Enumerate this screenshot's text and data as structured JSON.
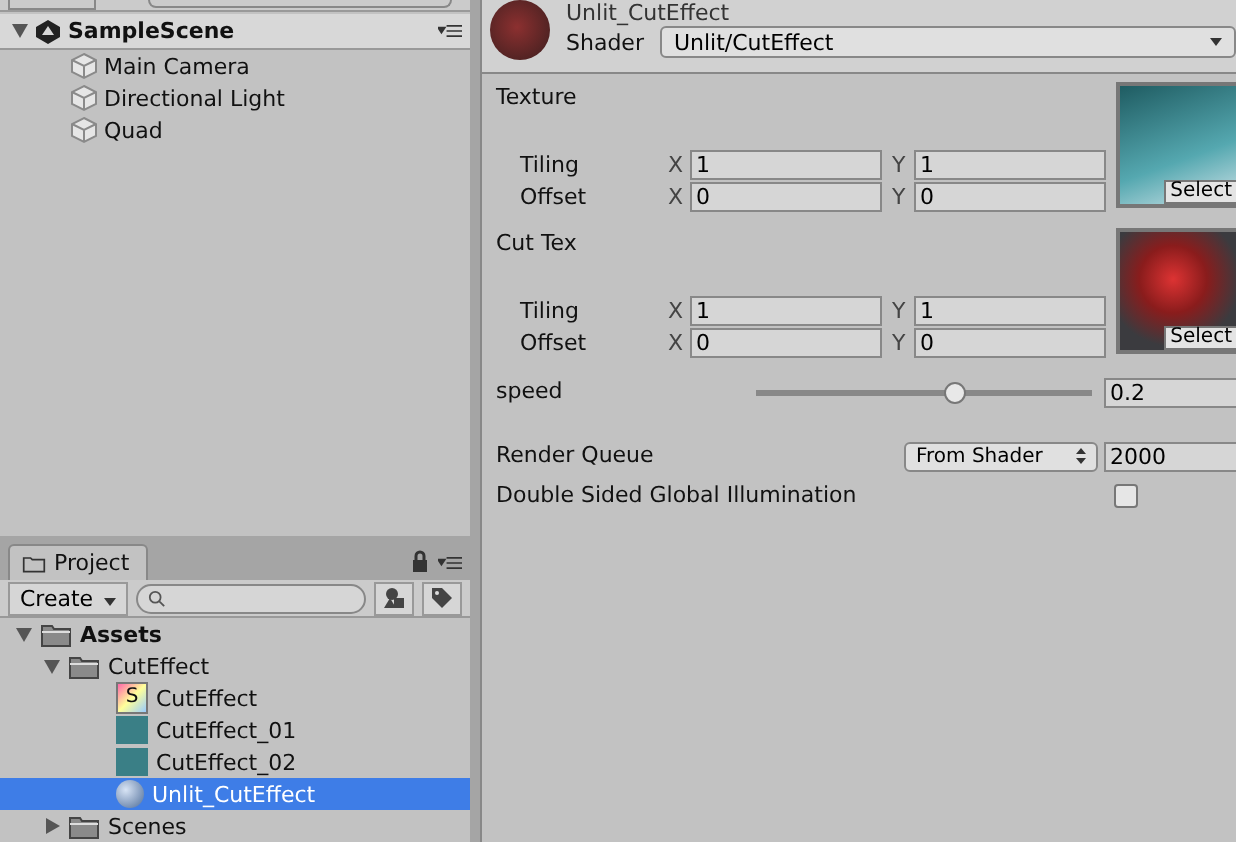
{
  "hierarchy": {
    "scene": "SampleScene",
    "items": [
      {
        "label": "Main Camera"
      },
      {
        "label": "Directional Light"
      },
      {
        "label": "Quad"
      }
    ]
  },
  "project": {
    "tab": "Project",
    "create": "Create",
    "tree": [
      {
        "label": "Assets",
        "kind": "folder",
        "expanded": true,
        "selected": false,
        "children": [
          {
            "label": "CutEffect",
            "kind": "folder",
            "expanded": true,
            "selected": false,
            "children": [
              {
                "label": "CutEffect",
                "kind": "shader",
                "icon_letter": "S",
                "selected": false
              },
              {
                "label": "CutEffect_01",
                "kind": "texture",
                "selected": false
              },
              {
                "label": "CutEffect_02",
                "kind": "texture",
                "selected": false
              },
              {
                "label": "Unlit_CutEffect",
                "kind": "material",
                "selected": true
              }
            ]
          },
          {
            "label": "Scenes",
            "kind": "folder",
            "expanded": false,
            "selected": false
          }
        ]
      }
    ]
  },
  "inspector": {
    "title": "Unlit_CutEffect",
    "shader_label": "Shader",
    "shader": "Unlit/CutEffect",
    "textures": [
      {
        "label": "Texture",
        "select": "Select",
        "rows": [
          {
            "label": "Tiling",
            "fields": [
              {
                "axis": "X",
                "value": "1"
              },
              {
                "axis": "Y",
                "value": "1"
              }
            ]
          },
          {
            "label": "Offset",
            "fields": [
              {
                "axis": "X",
                "value": "0"
              },
              {
                "axis": "Y",
                "value": "0"
              }
            ]
          }
        ]
      },
      {
        "label": "Cut Tex",
        "select": "Select",
        "rows": [
          {
            "label": "Tiling",
            "fields": [
              {
                "axis": "X",
                "value": "1"
              },
              {
                "axis": "Y",
                "value": "1"
              }
            ]
          },
          {
            "label": "Offset",
            "fields": [
              {
                "axis": "X",
                "value": "0"
              },
              {
                "axis": "Y",
                "value": "0"
              }
            ]
          }
        ]
      }
    ],
    "speed": {
      "label": "speed",
      "level": 0.59,
      "value": "0.2"
    },
    "render_queue": {
      "label": "Render Queue",
      "mode": "From Shader",
      "value": "2000"
    },
    "double_sided": {
      "label": "Double Sided Global Illumination",
      "checked": false
    }
  }
}
